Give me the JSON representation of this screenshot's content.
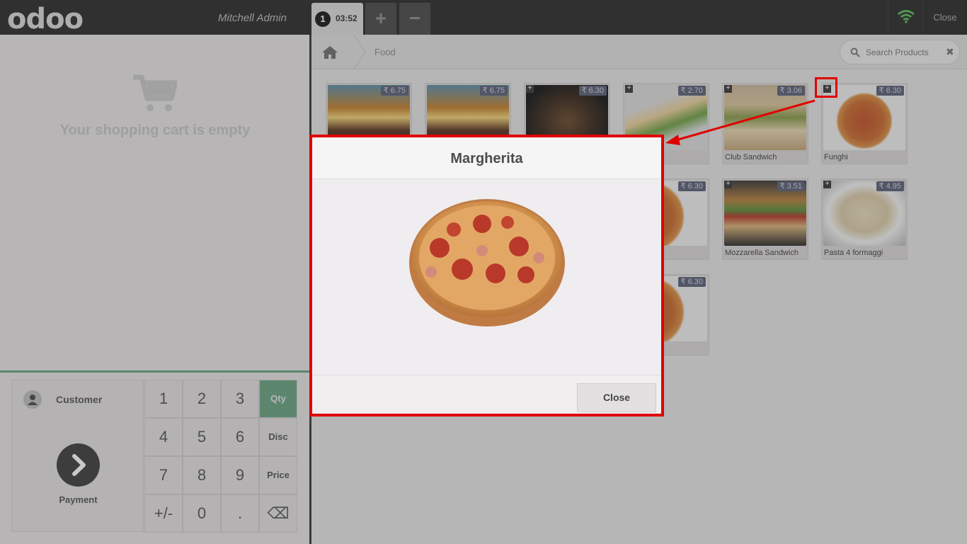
{
  "app": {
    "logo": "odoo",
    "user": "Mitchell Admin",
    "order_number": "1",
    "order_time": "03:52",
    "add_order": "+",
    "remove_order": "−",
    "close_label": "Close"
  },
  "cart": {
    "empty_message": "Your shopping cart is empty"
  },
  "actionpad": {
    "customer_label": "Customer",
    "payment_label": "Payment"
  },
  "numpad": {
    "keys": [
      "1",
      "2",
      "3",
      "Qty",
      "4",
      "5",
      "6",
      "Disc",
      "7",
      "8",
      "9",
      "Price",
      "+/-",
      "0",
      ".",
      "⌫"
    ],
    "active_mode": "Qty"
  },
  "breadcrumb": {
    "category": "Food"
  },
  "search": {
    "placeholder": "Search Products"
  },
  "products": [
    {
      "name": "",
      "price": "₹ 6.75"
    },
    {
      "name": "",
      "price": "₹ 6.75"
    },
    {
      "name": "",
      "price": "₹ 6.30"
    },
    {
      "name": "ry",
      "price": "₹ 2.70"
    },
    {
      "name": "Club Sandwich",
      "price": "₹ 3.06"
    },
    {
      "name": "Funghi",
      "price": "₹ 6.30"
    },
    {
      "name": "",
      "price": "₹ 6.30"
    },
    {
      "name": "Mozzarella Sandwich",
      "price": "₹ 3.51"
    },
    {
      "name": "Pasta 4 formaggi",
      "price": "₹ 4.95"
    },
    {
      "name": "",
      "price": "₹ 6.30"
    }
  ],
  "modal": {
    "title": "Margherita",
    "close_label": "Close"
  },
  "colors": {
    "topbar": "#2c2c2c",
    "accent_green": "#6aa383",
    "highlight_red": "#e00000",
    "price_badge": "#5a6078"
  }
}
